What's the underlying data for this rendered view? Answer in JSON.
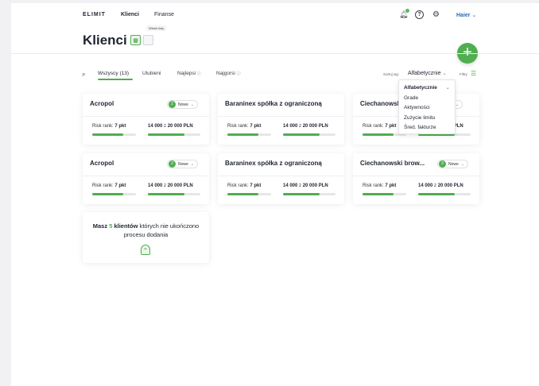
{
  "nav": {
    "logo": "ELIMIT",
    "links": [
      "Klienci",
      "Finanse"
    ],
    "user": "Haier",
    "chevron": "⌄"
  },
  "header": {
    "title": "Klienci",
    "view_tooltip": "Widok listy",
    "add_label": "+"
  },
  "tabs": [
    {
      "label": "Wszyscy (13)",
      "active": true
    },
    {
      "label": "Ulubieni"
    },
    {
      "label": "Najlepsi"
    },
    {
      "label": "Najgorsi"
    }
  ],
  "sort": {
    "label": "Sortuj wg:",
    "value": "Alfabetycznie",
    "options": [
      "Alfabetycznie",
      "Grade",
      "Aktywności",
      "Zużycie limitu",
      "Śred. fakturze"
    ]
  },
  "filters": {
    "label": "Filtry"
  },
  "cards": [
    {
      "name": "Acropol",
      "badge_count": "2",
      "badge_label": "Nowe",
      "risk_label": "Risk rank:",
      "risk_value": "7 pkt",
      "limit_used": "14 000",
      "limit_sep": "z",
      "limit_total": "20 000 PLN",
      "risk_fill": 0.7,
      "limit_fill": 0.7
    },
    {
      "name": "Baraninex spółka z ograniczoną",
      "badge_count": "",
      "badge_label": "",
      "risk_label": "Risk rank:",
      "risk_value": "7 pkt",
      "limit_used": "14 000",
      "limit_sep": "z",
      "limit_total": "20 000 PLN",
      "risk_fill": 0.7,
      "limit_fill": 0.7
    },
    {
      "name": "Ciechanowski brow...",
      "badge_count": "",
      "badge_label": "Nowe",
      "risk_label": "Risk rank:",
      "risk_value": "7 pkt",
      "limit_used": "14 000",
      "limit_sep": "z",
      "limit_total": "20 000 PLN",
      "risk_fill": 0.7,
      "limit_fill": 0.7
    },
    {
      "name": "Acropol",
      "badge_count": "2",
      "badge_label": "Nowe",
      "risk_label": "Risk rank:",
      "risk_value": "7 pkt",
      "limit_used": "14 000",
      "limit_sep": "z",
      "limit_total": "20 000 PLN",
      "risk_fill": 0.7,
      "limit_fill": 0.7
    },
    {
      "name": "Baraninex spółka z ograniczoną",
      "badge_count": "",
      "badge_label": "",
      "risk_label": "Risk rank:",
      "risk_value": "7 pkt",
      "limit_used": "14 000",
      "limit_sep": "z",
      "limit_total": "20 000 PLN",
      "risk_fill": 0.7,
      "limit_fill": 0.7
    },
    {
      "name": "Ciechanowski brow...",
      "badge_count": "3",
      "badge_label": "Nowe",
      "risk_label": "Risk rank:",
      "risk_value": "7 pkt",
      "limit_used": "14 000",
      "limit_sep": "z",
      "limit_total": "20 000 PLN",
      "risk_fill": 0.7,
      "limit_fill": 0.7
    }
  ],
  "pending": {
    "prefix": "Masz",
    "count": "5",
    "bold_word": "klientów",
    "rest": "których nie ukończono procesu dodania"
  },
  "colors": {
    "accent": "#4fae4f",
    "link": "#2b6cb0",
    "text": "#1f2430"
  }
}
